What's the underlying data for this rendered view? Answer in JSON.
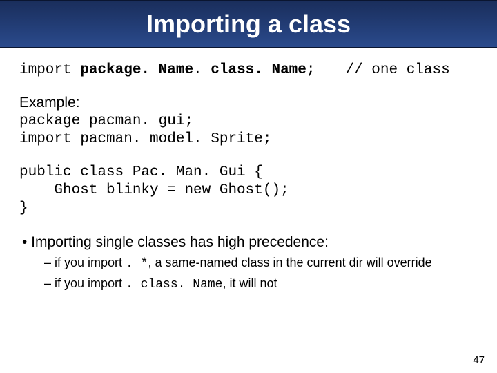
{
  "title": "Importing a class",
  "syntax": {
    "keyword": "import ",
    "pkg": "package. Name",
    "dot": ".",
    "cls": " class. Name",
    "semi": ";",
    "comment": "// one class"
  },
  "example_label": "Example:",
  "code1_line1": "package pacman. gui;",
  "code1_line2": "import pacman. model. Sprite;",
  "code2_line1": "public class Pac. Man. Gui {",
  "code2_line2": "    Ghost blinky = new Ghost();",
  "code2_line3": "}",
  "bullet_main": "• Importing single classes has high precedence:",
  "sub1_prefix": "– if you import ",
  "sub1_code": ". *",
  "sub1_suffix": ", a same-named class in the current dir will override",
  "sub2_prefix": "– if you import ",
  "sub2_code": ". class. Name",
  "sub2_suffix": ", it will not",
  "slide_number": "47"
}
